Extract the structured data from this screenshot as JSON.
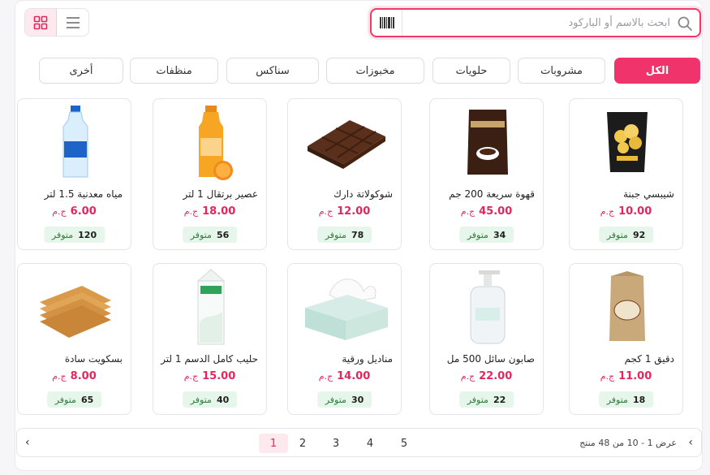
{
  "search": {
    "placeholder": "ابحث بالاسم أو الباركود"
  },
  "categories": [
    {
      "label": "الكل",
      "active": true
    },
    {
      "label": "مشروبات"
    },
    {
      "label": "حلويات"
    },
    {
      "label": "مخبوزات"
    },
    {
      "label": "سناكس"
    },
    {
      "label": "منظفات"
    },
    {
      "label": "أخرى"
    }
  ],
  "products": [
    {
      "name": "شيبسي جبنة",
      "price": "10.00",
      "currency": "ج.م",
      "stock": "92",
      "stock_label": "متوفر",
      "icon": "chips-bag"
    },
    {
      "name": "قهوة سريعة 200 جم",
      "price": "45.00",
      "currency": "ج.م",
      "stock": "34",
      "stock_label": "متوفر",
      "icon": "coffee-pack"
    },
    {
      "name": "شوكولاتة دارك",
      "price": "12.00",
      "currency": "ج.م",
      "stock": "78",
      "stock_label": "متوفر",
      "icon": "chocolate-bar"
    },
    {
      "name": "عصير برتقال 1 لتر",
      "price": "18.00",
      "currency": "ج.م",
      "stock": "56",
      "stock_label": "متوفر",
      "icon": "orange-juice"
    },
    {
      "name": "مياه معدنية 1.5 لتر",
      "price": "6.00",
      "currency": "ج.م",
      "stock": "120",
      "stock_label": "متوفر",
      "icon": "water-bottle"
    },
    {
      "name": "دقيق 1 كجم",
      "price": "11.00",
      "currency": "ج.م",
      "stock": "18",
      "stock_label": "متوفر",
      "icon": "flour-bag"
    },
    {
      "name": "صابون سائل 500 مل",
      "price": "22.00",
      "currency": "ج.م",
      "stock": "22",
      "stock_label": "متوفر",
      "icon": "soap-bottle"
    },
    {
      "name": "مناديل ورقية",
      "price": "14.00",
      "currency": "ج.م",
      "stock": "30",
      "stock_label": "متوفر",
      "icon": "tissue-box"
    },
    {
      "name": "حليب كامل الدسم 1 لتر",
      "price": "15.00",
      "currency": "ج.م",
      "stock": "40",
      "stock_label": "متوفر",
      "icon": "milk-carton"
    },
    {
      "name": "بسكويت سادة",
      "price": "8.00",
      "currency": "ج.م",
      "stock": "65",
      "stock_label": "متوفر",
      "icon": "biscuits"
    }
  ],
  "pagination": {
    "info": "عرض 1 - 10 من 48 منتج",
    "pages": [
      "1",
      "2",
      "3",
      "4",
      "5"
    ],
    "current": "1"
  }
}
